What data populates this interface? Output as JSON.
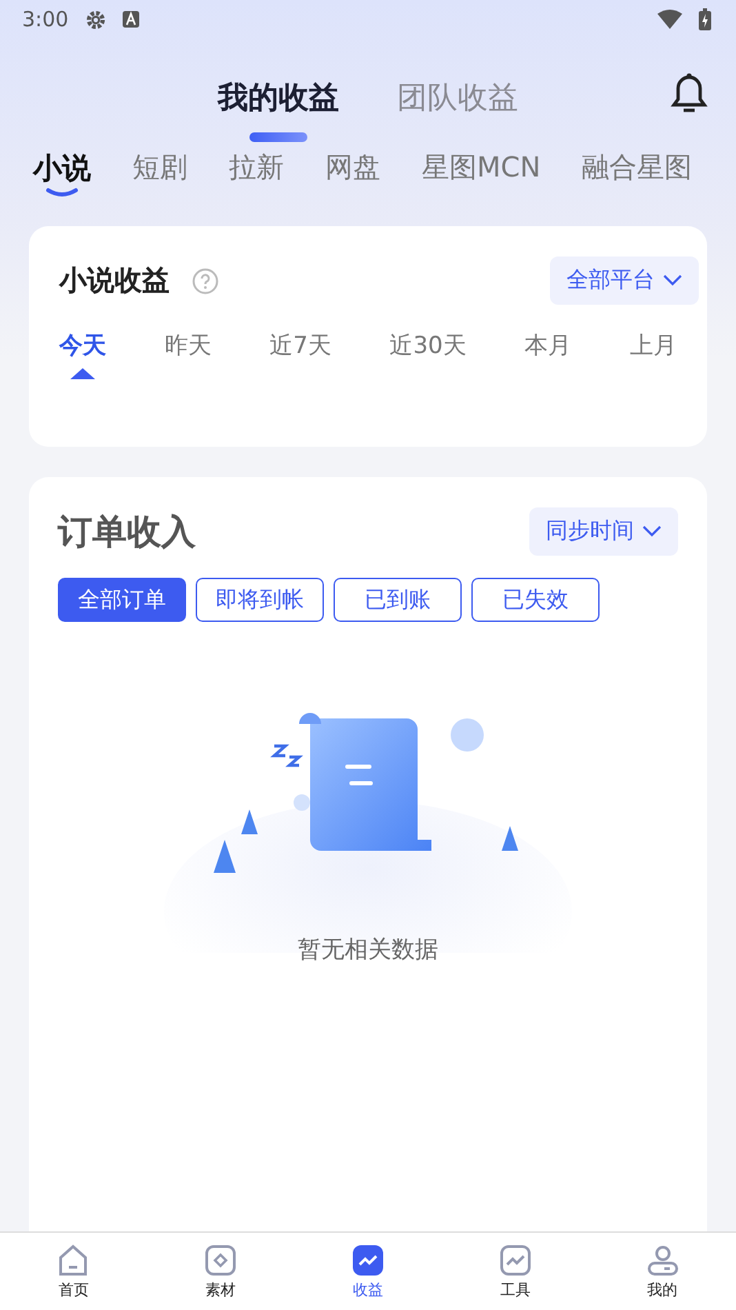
{
  "status_bar": {
    "time": "3:00"
  },
  "header_tabs": [
    {
      "label": "我的收益",
      "selected": true
    },
    {
      "label": "团队收益",
      "selected": false
    }
  ],
  "categories": [
    {
      "label": "小说",
      "selected": true
    },
    {
      "label": "短剧",
      "selected": false
    },
    {
      "label": "拉新",
      "selected": false
    },
    {
      "label": "网盘",
      "selected": false
    },
    {
      "label": "星图MCN",
      "selected": false
    },
    {
      "label": "融合星图",
      "selected": false
    }
  ],
  "earnings_card": {
    "title": "小说收益",
    "platform_select": "全部平台",
    "periods": [
      {
        "label": "今天",
        "selected": true
      },
      {
        "label": "昨天",
        "selected": false
      },
      {
        "label": "近7天",
        "selected": false
      },
      {
        "label": "近30天",
        "selected": false
      },
      {
        "label": "本月",
        "selected": false
      },
      {
        "label": "上月",
        "selected": false
      }
    ]
  },
  "orders_card": {
    "title": "订单收入",
    "sort_select": "同步时间",
    "filters": [
      {
        "label": "全部订单",
        "selected": true
      },
      {
        "label": "即将到帐",
        "selected": false
      },
      {
        "label": "已到账",
        "selected": false
      },
      {
        "label": "已失效",
        "selected": false
      }
    ],
    "empty_text": "暂无相关数据"
  },
  "bottom_nav": [
    {
      "label": "首页",
      "kind": "home",
      "selected": false
    },
    {
      "label": "素材",
      "kind": "material",
      "selected": false
    },
    {
      "label": "收益",
      "kind": "earnings",
      "selected": true
    },
    {
      "label": "工具",
      "kind": "tools",
      "selected": false
    },
    {
      "label": "我的",
      "kind": "me",
      "selected": false
    }
  ]
}
